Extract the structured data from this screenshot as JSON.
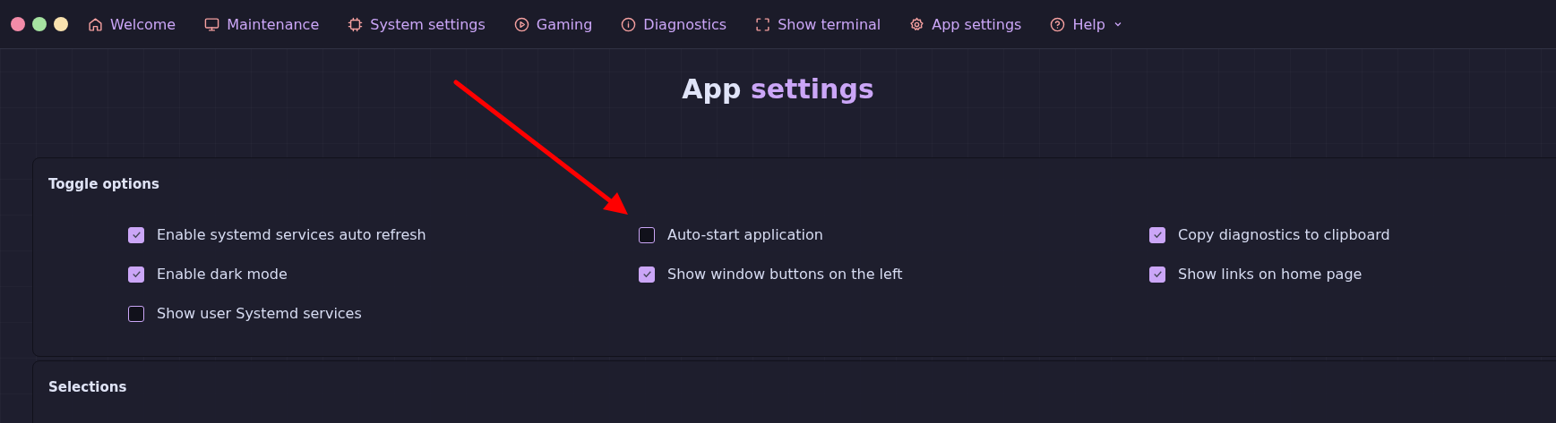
{
  "window_controls": [
    {
      "color": "#f38ba8"
    },
    {
      "color": "#a6e3a1"
    },
    {
      "color": "#f9e2af"
    }
  ],
  "nav": [
    {
      "label": "Welcome",
      "has_menu": false
    },
    {
      "label": "Maintenance",
      "has_menu": false
    },
    {
      "label": "System settings",
      "has_menu": false
    },
    {
      "label": "Gaming",
      "has_menu": false
    },
    {
      "label": "Diagnostics",
      "has_menu": false
    },
    {
      "label": "Show terminal",
      "has_menu": false
    },
    {
      "label": "App settings",
      "has_menu": false
    },
    {
      "label": "Help",
      "has_menu": true
    }
  ],
  "heading": {
    "lead": "App",
    "accent": "settings"
  },
  "sections": [
    {
      "title": "Toggle options",
      "options": [
        {
          "label": "Enable systemd services auto refresh",
          "checked": true
        },
        {
          "label": "Auto-start application",
          "checked": false
        },
        {
          "label": "Copy diagnostics to clipboard",
          "checked": true
        },
        {
          "label": "Enable dark mode",
          "checked": true
        },
        {
          "label": "Show window buttons on the left",
          "checked": true
        },
        {
          "label": "Show links on home page",
          "checked": true
        },
        {
          "label": "Show user Systemd services",
          "checked": false
        }
      ]
    },
    {
      "title": "Selections"
    }
  ]
}
